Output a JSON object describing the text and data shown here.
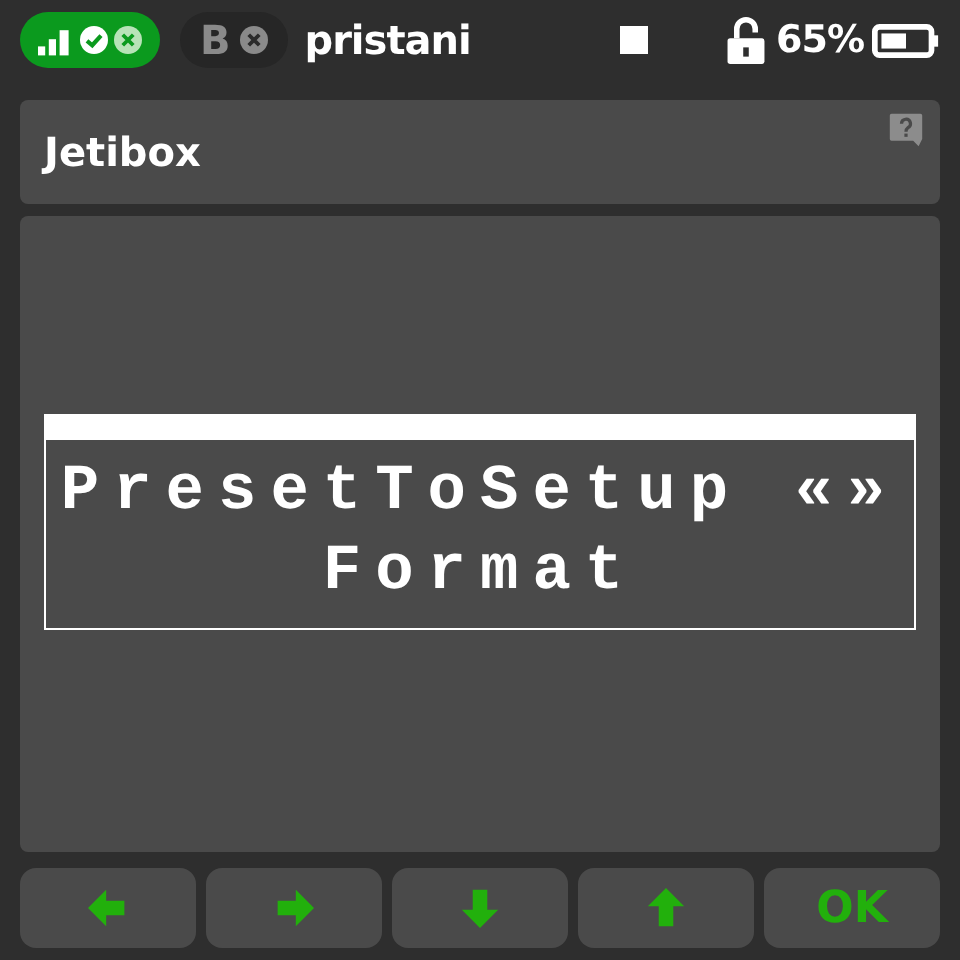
{
  "status_bar": {
    "receiver_label": "B",
    "model_name": "pristani",
    "battery_percent": "65%"
  },
  "title": "Jetibox",
  "jetibox": {
    "lines": [
      "PresetToSetup «»",
      "Format"
    ]
  },
  "buttons": [
    {
      "kind": "left"
    },
    {
      "kind": "right"
    },
    {
      "kind": "down"
    },
    {
      "kind": "up"
    },
    {
      "kind": "text",
      "label": "OK"
    }
  ]
}
